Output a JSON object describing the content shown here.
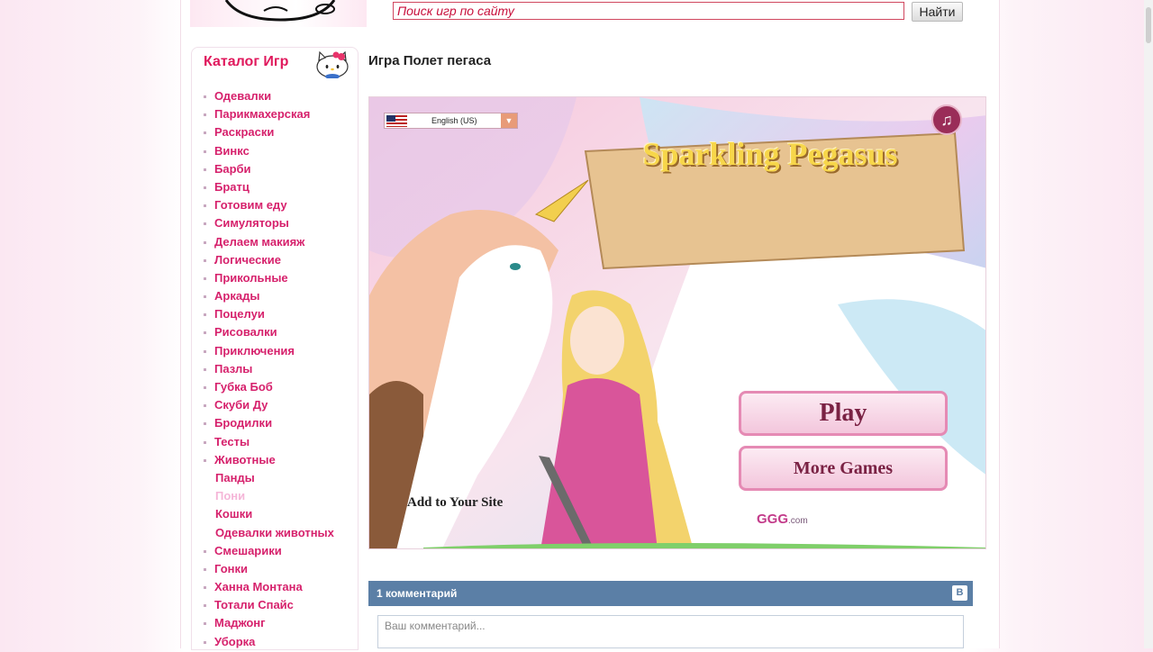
{
  "search": {
    "placeholder": "Поиск игр по сайту",
    "button_label": "Найти"
  },
  "sidebar": {
    "title": "Каталог Игр",
    "items": [
      {
        "label": "Одевалки",
        "type": "item"
      },
      {
        "label": "Парикмахерская",
        "type": "item"
      },
      {
        "label": "Раскраски",
        "type": "item"
      },
      {
        "label": "Винкс",
        "type": "item"
      },
      {
        "label": "Барби",
        "type": "item"
      },
      {
        "label": "Братц",
        "type": "item"
      },
      {
        "label": "Готовим еду",
        "type": "item"
      },
      {
        "label": "Симуляторы",
        "type": "item"
      },
      {
        "label": "Делаем макияж",
        "type": "item"
      },
      {
        "label": "Логические",
        "type": "item"
      },
      {
        "label": "Прикольные",
        "type": "item"
      },
      {
        "label": "Аркады",
        "type": "item"
      },
      {
        "label": "Поцелуи",
        "type": "item"
      },
      {
        "label": "Рисовалки",
        "type": "item"
      },
      {
        "label": "Приключения",
        "type": "item"
      },
      {
        "label": "Пазлы",
        "type": "item"
      },
      {
        "label": "Губка Боб",
        "type": "item"
      },
      {
        "label": "Скуби Ду",
        "type": "item"
      },
      {
        "label": "Бродилки",
        "type": "item"
      },
      {
        "label": "Тесты",
        "type": "item"
      },
      {
        "label": "Животные",
        "type": "item"
      },
      {
        "label": "Панды",
        "type": "sub"
      },
      {
        "label": "Пони",
        "type": "active"
      },
      {
        "label": "Кошки",
        "type": "sub"
      },
      {
        "label": "Одевалки животных",
        "type": "sub"
      },
      {
        "label": "Смешарики",
        "type": "item"
      },
      {
        "label": "Гонки",
        "type": "item"
      },
      {
        "label": "Ханна Монтана",
        "type": "item"
      },
      {
        "label": "Тотали Спайс",
        "type": "item"
      },
      {
        "label": "Маджонг",
        "type": "item"
      },
      {
        "label": "Уборка",
        "type": "item"
      }
    ]
  },
  "main": {
    "title": "Игра Полет пегаса"
  },
  "game": {
    "language": "English (US)",
    "logo_title": "Sparkling Pegasus",
    "play_label": "Play",
    "more_games_label": "More Games",
    "add_to_site_label": "Add to Your Site",
    "sponsor_text": "GGG",
    "sponsor_suffix": ".com",
    "music_icon": "music-note-icon"
  },
  "comments": {
    "count_label": "1 комментарий",
    "vk_badge": "В",
    "placeholder": "Ваш комментарий..."
  },
  "colors": {
    "accent": "#d6216c",
    "comment_bar": "#5b7fa6"
  }
}
